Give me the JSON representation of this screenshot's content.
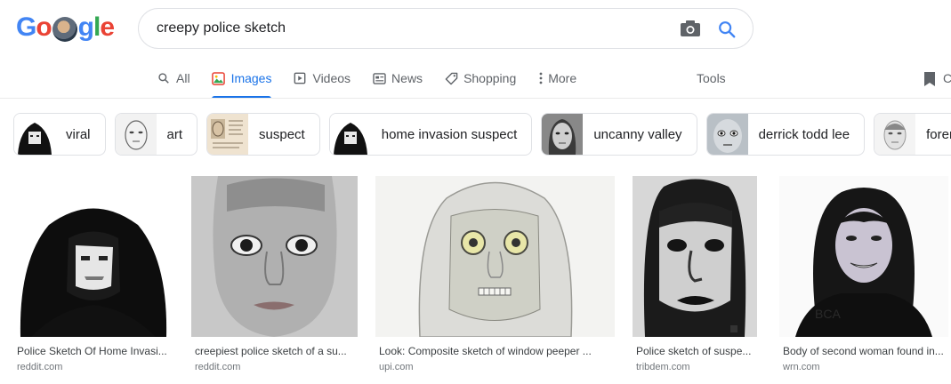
{
  "logo": {
    "text_g": "Go",
    "text_rest": "gle"
  },
  "search": {
    "query": "creepy police sketch"
  },
  "tabs": [
    {
      "label": "All",
      "icon": "search-icon"
    },
    {
      "label": "Images",
      "icon": "image-icon"
    },
    {
      "label": "Videos",
      "icon": "video-icon"
    },
    {
      "label": "News",
      "icon": "news-icon"
    },
    {
      "label": "Shopping",
      "icon": "tag-icon"
    },
    {
      "label": "More",
      "icon": "more-vert-icon"
    }
  ],
  "tools_label": "Tools",
  "saved_label": "C",
  "chips": [
    {
      "label": "viral"
    },
    {
      "label": "art"
    },
    {
      "label": "suspect"
    },
    {
      "label": "home invasion suspect"
    },
    {
      "label": "uncanny valley"
    },
    {
      "label": "derrick todd lee"
    },
    {
      "label": "forensi"
    }
  ],
  "results": [
    {
      "title": "Police Sketch Of Home Invasi...",
      "source": "reddit.com"
    },
    {
      "title": "creepiest police sketch of a su...",
      "source": "reddit.com"
    },
    {
      "title": "Look: Composite sketch of window peeper ...",
      "source": "upi.com"
    },
    {
      "title": "Police sketch of suspe...",
      "source": "tribdem.com"
    },
    {
      "title": "Body of second woman found in...",
      "source": "wrn.com"
    }
  ],
  "colors": {
    "accent": "#1a73e8",
    "text": "#202124",
    "muted": "#5f6368",
    "border": "#dfe1e5"
  }
}
